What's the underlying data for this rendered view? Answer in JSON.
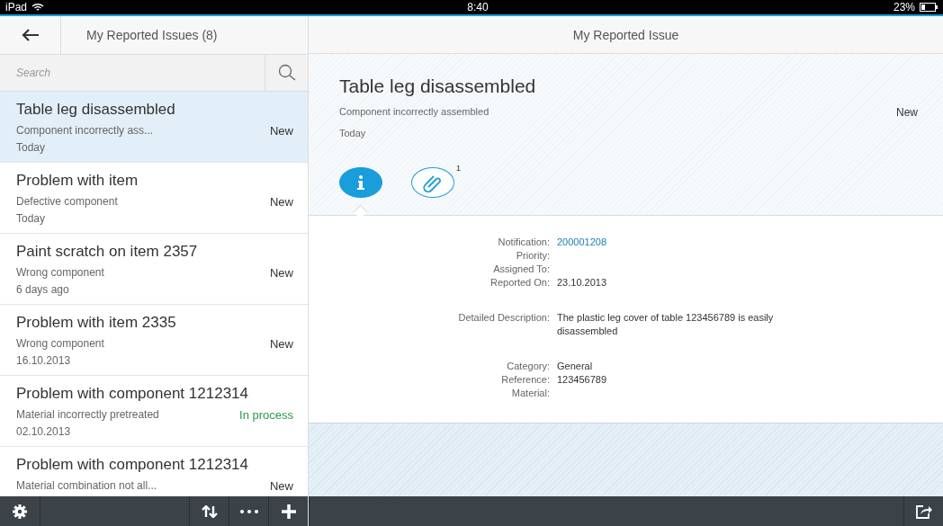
{
  "status_bar": {
    "device": "iPad",
    "time": "8:40",
    "battery": "23%"
  },
  "master": {
    "title": "My Reported Issues (8)",
    "search": {
      "placeholder": "Search"
    },
    "items": [
      {
        "title": "Table leg disassembled",
        "subtitle": "Component incorrectly ass...",
        "status": "New",
        "color": "#333333",
        "date": "Today",
        "selected": true
      },
      {
        "title": "Problem with item",
        "subtitle": "Defective component",
        "status": "New",
        "color": "#333333",
        "date": "Today",
        "selected": false
      },
      {
        "title": "Paint scratch on item 2357",
        "subtitle": "Wrong component",
        "status": "New",
        "color": "#333333",
        "date": "6 days ago",
        "selected": false
      },
      {
        "title": "Problem with item 2335",
        "subtitle": "Wrong component",
        "status": "New",
        "color": "#333333",
        "date": "16.10.2013",
        "selected": false
      },
      {
        "title": "Problem with component 1212314",
        "subtitle": "Material incorrectly pretreated",
        "status": "In process",
        "color": "#2b9a48",
        "date": "02.10.2013",
        "selected": false
      },
      {
        "title": "Problem with component 1212314",
        "subtitle": "Material combination not all...",
        "status": "New",
        "color": "#333333",
        "selected": false
      }
    ]
  },
  "detail": {
    "title": "My Reported Issue",
    "header": {
      "title": "Table leg disassembled",
      "subtitle": "Component incorrectly assembled",
      "status": "New",
      "date": "Today"
    },
    "tabs": [
      {
        "kind": "info",
        "selected": true
      },
      {
        "kind": "attachments",
        "count": "1",
        "selected": false
      }
    ],
    "groups": [
      [
        {
          "label": "Notification:",
          "value": "200001208",
          "kind": "link"
        },
        {
          "label": "Priority:"
        },
        {
          "label": "Assigned To:"
        },
        {
          "label": "Reported On:",
          "value": "23.10.2013",
          "kind": "text"
        }
      ],
      [
        {
          "label": "Detailed Description:",
          "value": "The plastic leg cover of table 123456789 is easily disassembled",
          "kind": "text"
        }
      ],
      [
        {
          "label": "Category:",
          "value": "General",
          "kind": "text"
        },
        {
          "label": "Reference:",
          "value": "123456789",
          "kind": "text"
        },
        {
          "label": "Material:"
        }
      ]
    ]
  }
}
